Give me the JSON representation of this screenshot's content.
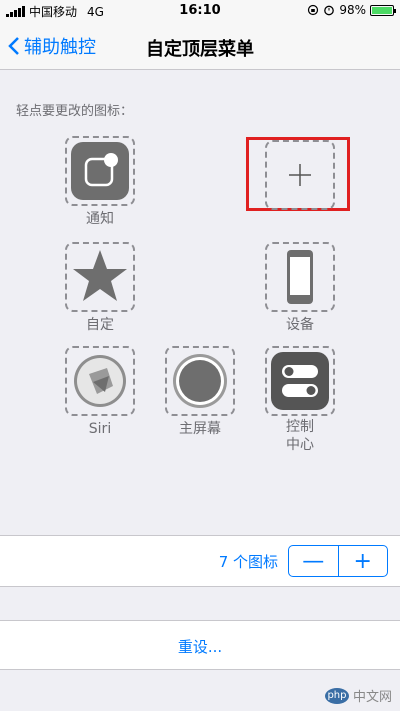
{
  "status_bar": {
    "carrier": "中国移动",
    "network": "4G",
    "time": "16:10",
    "battery_percent": "98%",
    "battery_level": 0.98
  },
  "nav": {
    "back_label": "辅助触控",
    "title": "自定顶层菜单"
  },
  "section": {
    "label": "轻点要更改的图标："
  },
  "icons": [
    {
      "label": "通知",
      "icon": "notification-icon"
    },
    {
      "label": "",
      "icon": "plus-icon"
    },
    {
      "label": "自定",
      "icon": "star-icon"
    },
    {
      "label": "设备",
      "icon": "device-icon"
    },
    {
      "label": "Siri",
      "icon": "siri-icon"
    },
    {
      "label": "主屏幕",
      "icon": "home-icon"
    },
    {
      "label": "控制\n中心",
      "icon": "control-center-icon"
    }
  ],
  "stepper": {
    "count_label": "7 个图标",
    "minus": "—",
    "plus": "+"
  },
  "reset": {
    "label": "重设..."
  },
  "watermark": {
    "text": "中文网",
    "logo": "php"
  },
  "colors": {
    "accent": "#007aff",
    "highlight": "#e02020",
    "background": "#efeff4"
  }
}
